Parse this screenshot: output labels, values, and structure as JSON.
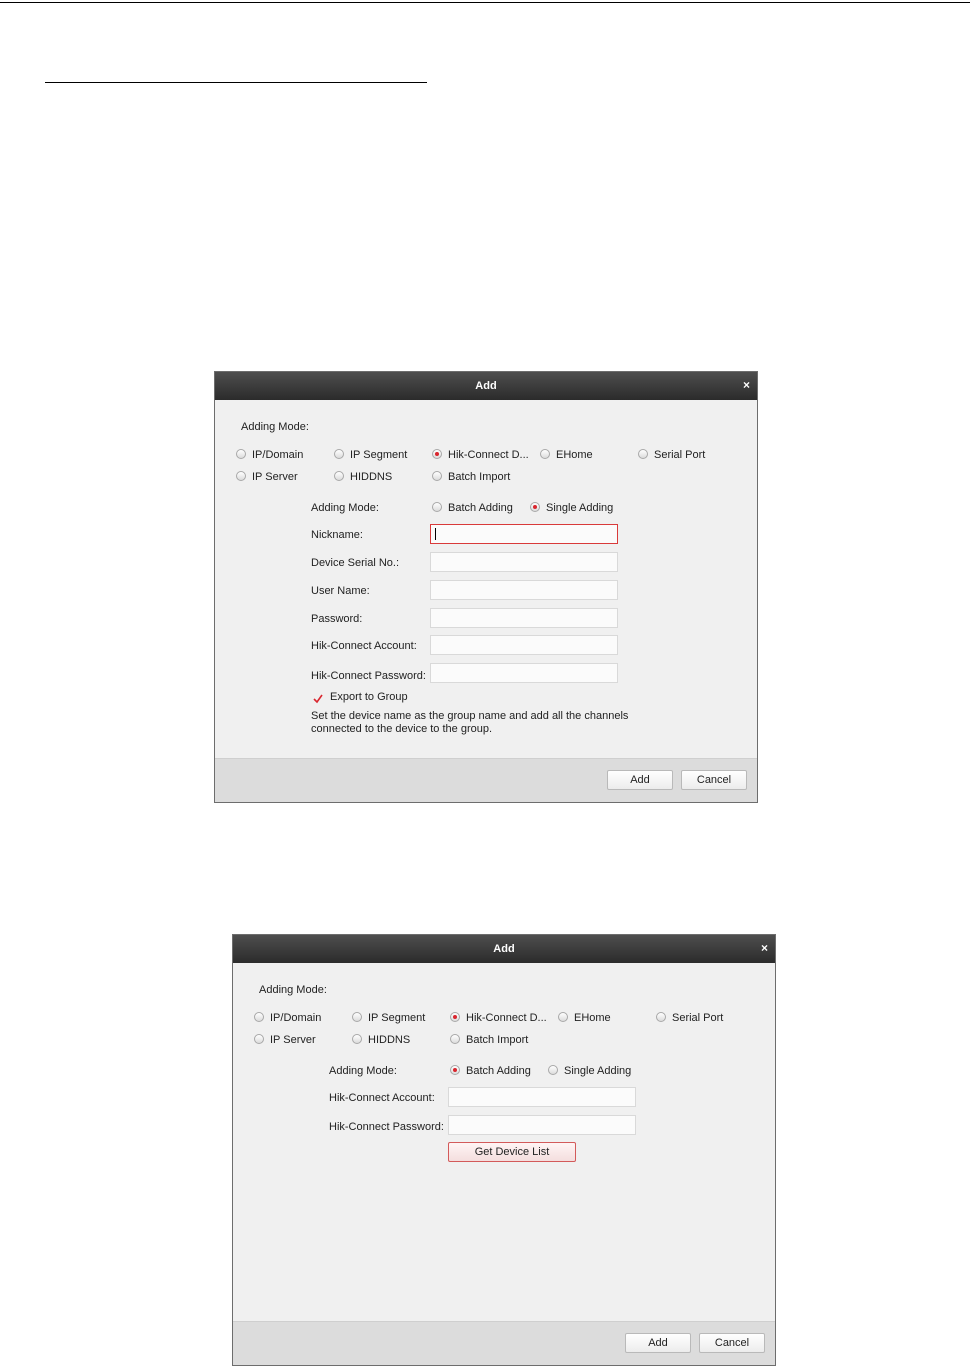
{
  "add_dialog": {
    "title": "Add",
    "close": "×",
    "adding_mode_label": "Adding Mode:",
    "modes": [
      {
        "label": "IP/Domain",
        "selected": false
      },
      {
        "label": "IP Segment",
        "selected": false
      },
      {
        "label": "Hik-Connect D...",
        "selected": true
      },
      {
        "label": "EHome",
        "selected": false
      },
      {
        "label": "Serial Port",
        "selected": false
      },
      {
        "label": "IP Server",
        "selected": false
      },
      {
        "label": "HIDDNS",
        "selected": false
      },
      {
        "label": "Batch Import",
        "selected": false
      }
    ],
    "sub_mode_label": "Adding Mode:",
    "batch_adding": "Batch Adding",
    "single_adding": "Single Adding",
    "add_button": "Add",
    "cancel_button": "Cancel"
  },
  "single_form": {
    "sub_mode_selected": "Single Adding",
    "fields": {
      "nickname": "Nickname:",
      "serial": "Device Serial No.:",
      "username": "User Name:",
      "password": "Password:",
      "account": "Hik-Connect Account:",
      "hc_password": "Hik-Connect Password:"
    },
    "export_to_group": {
      "label": "Export to Group",
      "checked": true
    },
    "help_text_line1": "Set the device name as the group name and add all the channels",
    "help_text_line2": "connected to the device to the group."
  },
  "batch_form": {
    "sub_mode_selected": "Batch Adding",
    "fields": {
      "account": "Hik-Connect Account:",
      "hc_password": "Hik-Connect Password:"
    },
    "get_device_list_button": "Get Device List"
  },
  "colors": {
    "accent_red": "#d9262e",
    "titlebar": "#2b2b2b",
    "dialog_bg": "#f0f0f0"
  },
  "icons": {
    "close": "close-icon",
    "checkmark": "checkmark-icon"
  }
}
